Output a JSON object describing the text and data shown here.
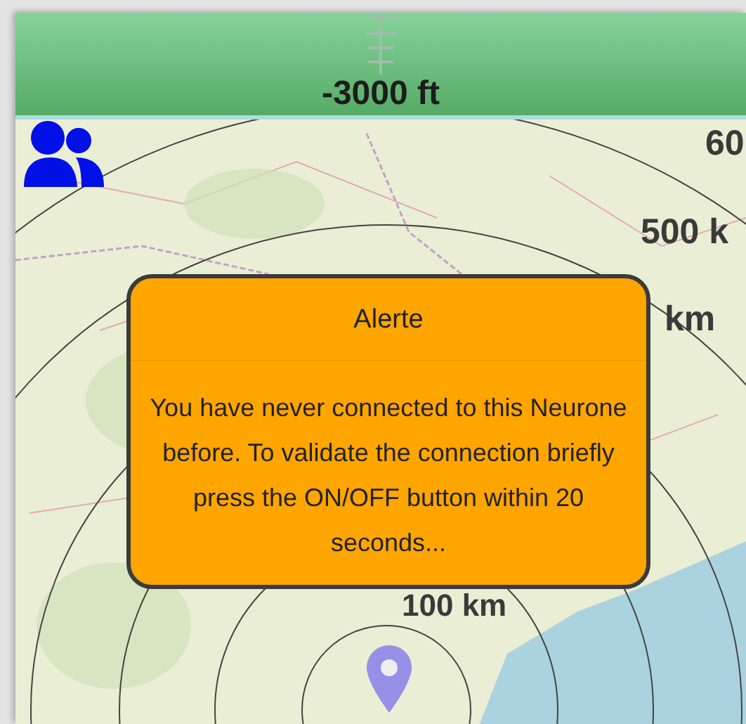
{
  "header": {
    "altitude": "-3000 ft"
  },
  "map": {
    "range_labels": [
      "60",
      "500 k",
      "km",
      "100 km"
    ]
  },
  "dialog": {
    "title": "Alerte",
    "message": "You have never connected to this Neurone before. To validate the connection briefly press the ON/OFF button within 20 seconds..."
  }
}
